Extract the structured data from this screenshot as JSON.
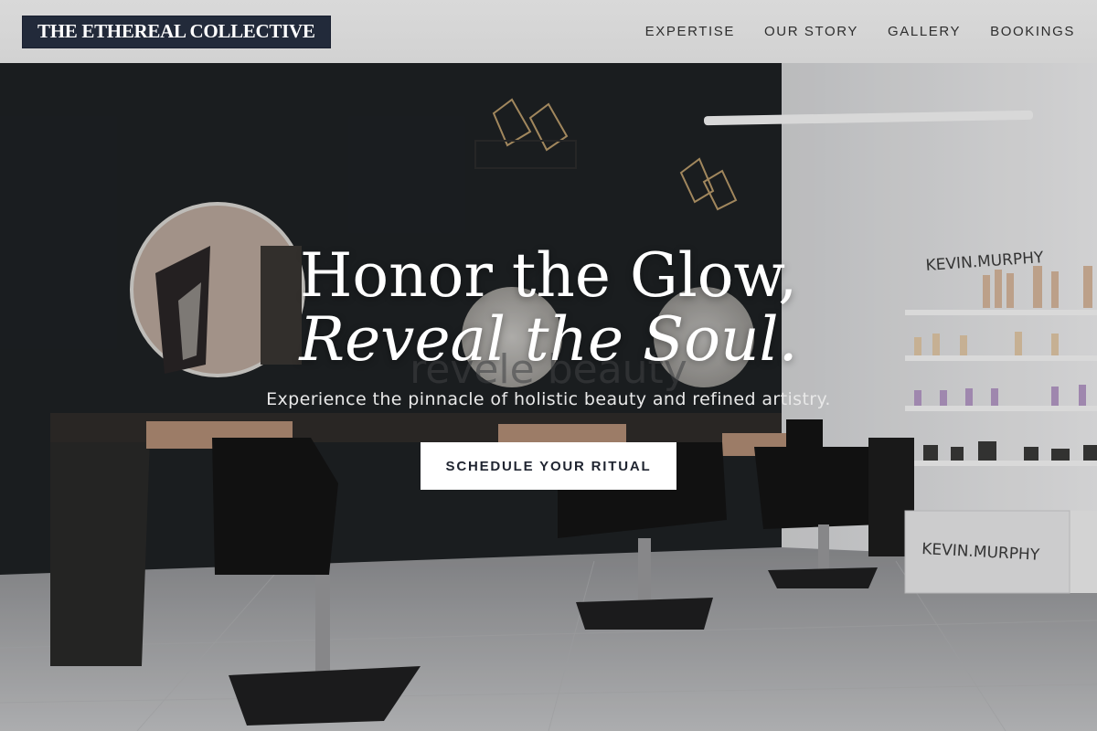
{
  "brand": {
    "name": "THE ETHEREAL COLLECTIVE"
  },
  "nav": {
    "items": [
      {
        "label": "EXPERTISE"
      },
      {
        "label": "OUR STORY"
      },
      {
        "label": "GALLERY"
      },
      {
        "label": "BOOKINGS"
      }
    ]
  },
  "hero": {
    "headline_line1": "Honor the Glow,",
    "headline_line2": "Reveal the Soul.",
    "tagline": "Experience the pinnacle of holistic beauty and refined artistry.",
    "cta_label": "SCHEDULE YOUR RITUAL",
    "background_text": {
      "wall_sign": "revele beauty",
      "shelf_brand": "KEVIN.MURPHY",
      "counter_brand": "KEVIN.MURPHY"
    }
  },
  "colors": {
    "header_bg": "#d6d6d6",
    "logo_bg": "#222a3a",
    "cta_bg": "#ffffff",
    "cta_text": "#1f2430",
    "wall_dark": "#1e2124",
    "wall_light": "#e9e9ea"
  }
}
